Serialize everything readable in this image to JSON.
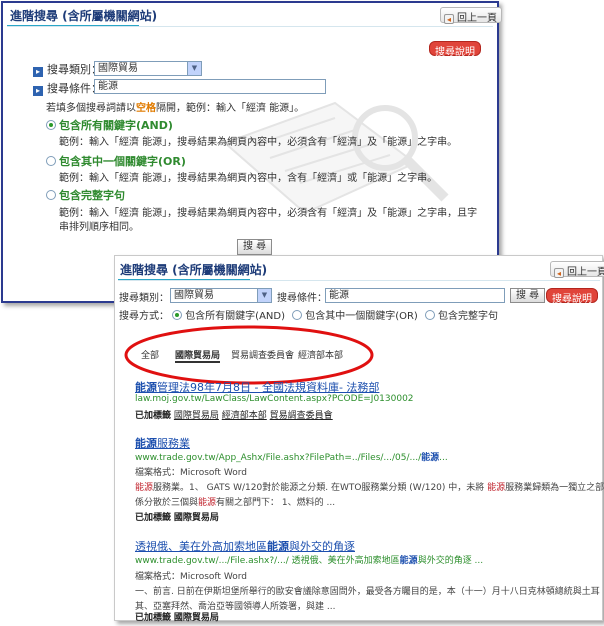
{
  "panel1": {
    "title": "進階搜尋 (含所屬機關網站)",
    "back_label": "回上一頁",
    "help_label": "搜尋說明",
    "category_label": "搜尋類別：",
    "category_value": "國際貿易",
    "condition_label": "搜尋條件：",
    "condition_value": "能源",
    "hint_prefix": "若填多個搜尋詞請以",
    "hint_emph": "空格",
    "hint_suffix": "隔開，範例：輸入「經濟 能源」。",
    "options": [
      {
        "title": "包含所有關鍵字(AND)",
        "selected": true,
        "desc1": "範例：輸入「經濟 能源」，搜尋結果為網頁內容中，必須含有「經濟」及「能源」之字串。",
        "desc2": ""
      },
      {
        "title": "包含其中一個關鍵字(OR)",
        "selected": false,
        "desc1": "範例：輸入「經濟 能源」，搜尋結果為網頁內容中，含有「經濟」或「能源」之字串。",
        "desc2": ""
      },
      {
        "title": "包含完整字句",
        "selected": false,
        "desc1": "範例：輸入「經濟 能源」，搜尋結果為網頁內容中，必須含有「經濟」及「能源」之字串，且字",
        "desc2": "串排列順序相同。"
      }
    ],
    "search_label": "搜 尋"
  },
  "panel2": {
    "title": "進階搜尋 (含所屬機關網站)",
    "back_label": "回上一頁",
    "category_label": "搜尋類別：",
    "category_value": "國際貿易",
    "condition_label": "搜尋條件：",
    "condition_value": "能源",
    "search_label": "搜 尋",
    "help_label": "搜尋說明",
    "mode_label": "搜尋方式：",
    "modes": [
      "包含所有關鍵字(AND)",
      "包含其中一個關鍵字(OR)",
      "包含完整字句"
    ],
    "tabs": [
      "全部",
      "國際貿易局",
      "貿易調查委員會",
      "經濟部本部"
    ],
    "results": [
      {
        "title_hl": "能源",
        "title_rest": "管理法98年7月8日 - 全國法規資料庫- 法務部",
        "url": "law.moj.gov.tw/LawClass/LawContent.aspx?PCODE=J0130002",
        "meta": "",
        "snippet1": "",
        "snippet2": "",
        "tags_label": "已加標籤",
        "tags": [
          "國際貿易局",
          "經濟部本部",
          "貿易調查委員會"
        ]
      },
      {
        "title_hl": "能源",
        "title_rest": "服務業",
        "url_pre": "www.trade.gov.tw/App_Ashx/File.ashx?FilePath=../Files/.../05/.../",
        "url_hl": "能源",
        "url_post": "...",
        "meta": "檔案格式：Microsoft Word",
        "snippet1_hl": "能源",
        "snippet1": "服務業。1、 GATS W/120對於能源之分類. 在WTO服務業分類 (W/120) 中，未將 ",
        "snippet1_hl2": "能源",
        "snippet1_end": "服務業歸類為一獨立之部門，",
        "snippet2_pre": "係分散於三個與",
        "snippet2_hl": "能源",
        "snippet2": "有關之部門下： 1、燃料的 ...",
        "tags_label": "已加標籤",
        "tags": [
          "國際貿易局"
        ]
      },
      {
        "title_pre": "透視俄、美在外高加索地區",
        "title_hl": "能源",
        "title_rest": "與外交的角逐",
        "url_pre": "www.trade.gov.tw/.../File.ashx?/.../ 透視俄、美在外高加索地區",
        "url_hl": "能源",
        "url_post": "與外交的角逐 ...",
        "meta": "檔案格式：Microsoft Word",
        "snippet1": "一、前言. 日前在伊斯坦堡所舉行的歐安會議除意固問外，最受各方矚目的是，本（十一）月十八日克林頓總統與土耳",
        "snippet2": "其、亞塞拜然、喬治亞等國領導人所簽署，與建 ...",
        "tags_label": "已加標籤",
        "tags": [
          "國際貿易局"
        ]
      }
    ]
  }
}
